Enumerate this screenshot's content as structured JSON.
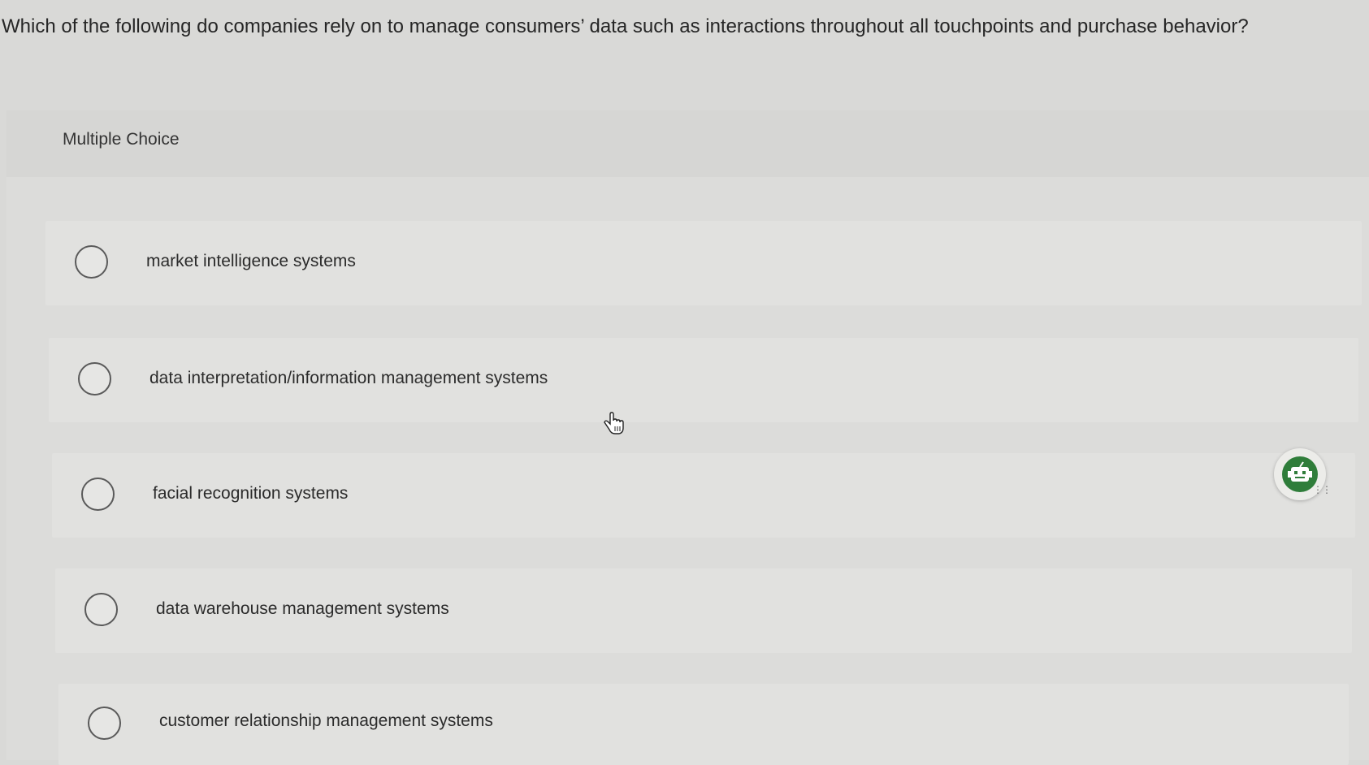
{
  "question": {
    "text": "Which of the following do companies rely on to manage consumers’ data such as interactions throughout all touchpoints and purchase behavior?"
  },
  "panel": {
    "type_label": "Multiple Choice"
  },
  "options": [
    {
      "label": "market intelligence systems",
      "selected": false
    },
    {
      "label": "data interpretation/information management systems",
      "selected": false
    },
    {
      "label": "facial recognition systems",
      "selected": false
    },
    {
      "label": "data warehouse management systems",
      "selected": false
    },
    {
      "label": "customer relationship management systems",
      "selected": false
    }
  ],
  "icons": {
    "cursor": "hand-pointer-icon",
    "widget": "reader-assistant-icon"
  },
  "colors": {
    "background": "#d9d9d7",
    "widget_accent": "#2f7d3a"
  }
}
